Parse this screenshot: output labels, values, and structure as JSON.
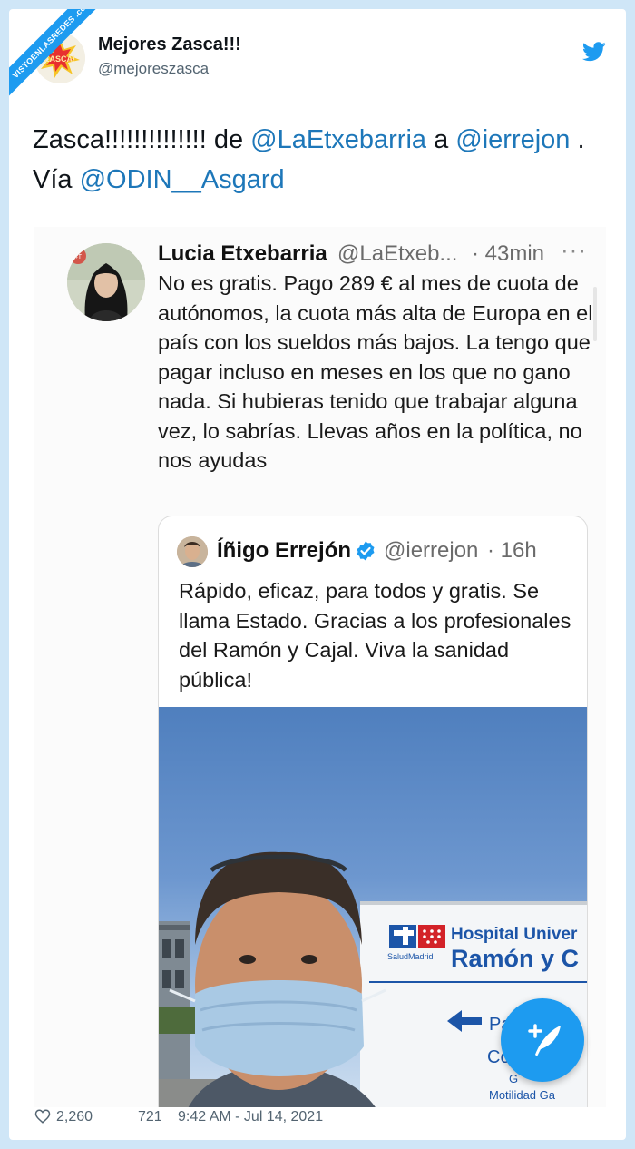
{
  "ribbon": "VISTOENLASREDES .com",
  "author": {
    "name": "Mejores Zasca!!!",
    "handle": "@mejoreszasca",
    "avatar_text": "ZASCA!"
  },
  "tweet": {
    "text_before": "Zasca!!!!!!!!!!!!!! de ",
    "mention1": "@LaEtxebarria",
    "text_mid": " a ",
    "mention2": "@ierrejon",
    "text_via": " . Vía ",
    "mention3": "@ODIN__Asgard"
  },
  "screenshot": {
    "author_name": "Lucia Etxebarria",
    "author_handle": "@LaEtxeb...",
    "time": "· 43min",
    "more": "···",
    "body": "No es gratis. Pago 289 € al mes de cuota de autónomos, la cuota más alta de Europa en el país con los sueldos más bajos. La tengo que pagar incluso en meses en los que no gano nada. Si hubieras tenido que trabajar alguna vez, lo sabrías. Llevas años en la política, no nos ayudas",
    "quote": {
      "author_name": "Íñigo Errejón",
      "author_handle": "@ierrejon",
      "time": "· 16h",
      "body": "Rápido, eficaz, para todos y gratis. Se llama Estado. Gracias a los profesionales del Ramón y Cajal. Viva la sanidad pública!",
      "photo": {
        "sign_brand": "SaludMadrid",
        "sign_line1": "Hospital Univer",
        "sign_line2": "Ramón y C",
        "sign_arrow_text": "Pab",
        "sign_line3": "Co",
        "sign_line4": "G",
        "sign_line5": "Motilidad Ga"
      }
    }
  },
  "footer": {
    "likes": "2,260",
    "retweets": "721",
    "timestamp": "9:42 AM - Jul 14, 2021"
  },
  "colors": {
    "accent": "#1d9bf0",
    "mention": "#1d77b9"
  }
}
